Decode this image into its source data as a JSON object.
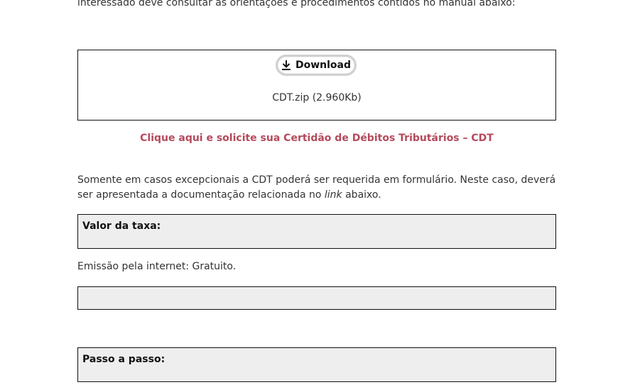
{
  "intro": {
    "text": "interessado deve consultar as orientações e procedimentos contidos no manual abaixo:"
  },
  "download": {
    "button_label": "Download",
    "icon": "download-arrow-icon",
    "file_label": "CDT.zip (2.960Kb)"
  },
  "cdt_link": {
    "text": "Clique aqui e solicite sua Certidão de Débitos Tributários – CDT",
    "color": "#b5495b"
  },
  "paragraph": {
    "before": "Somente em casos excepcionais a CDT poderá ser requerida em formulário. Neste caso, deverá ser apresentada a documentação relacionada no ",
    "emphasis": "link",
    "after": " abaixo."
  },
  "taxa": {
    "title": "Valor da taxa:",
    "emissao": "Emissão pela internet: Gratuito."
  },
  "passo": {
    "title": "Passo a passo:"
  },
  "colors": {
    "box_background": "#eeeeee",
    "text": "#333333"
  }
}
